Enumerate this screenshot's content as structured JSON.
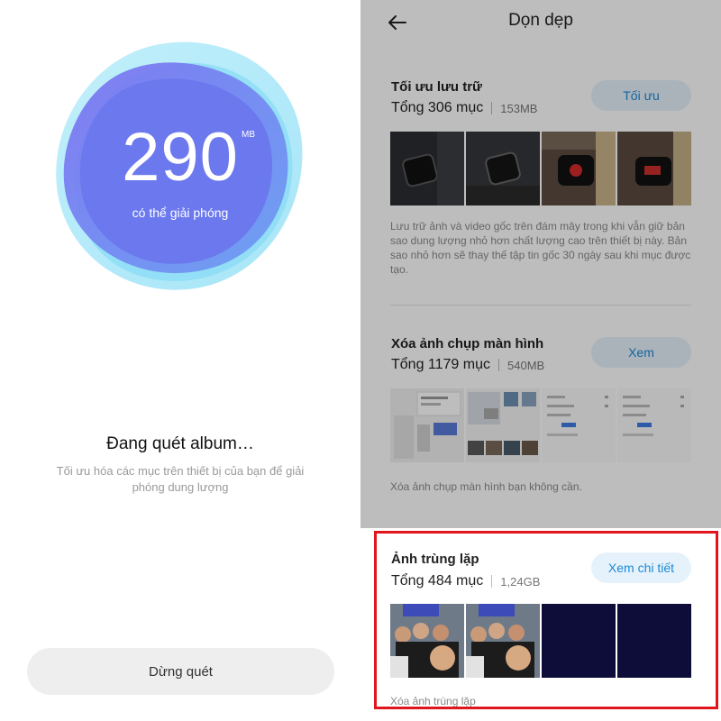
{
  "scan_screen": {
    "size_value": "290",
    "size_unit": "MB",
    "size_caption": "có thể giải phóng",
    "status_title": "Đang quét album…",
    "status_desc": "Tối ưu hóa các mục trên thiết bị của bạn để giải phóng dung lượng",
    "stop_button": "Dừng quét"
  },
  "cleanup_screen": {
    "title": "Dọn dẹp",
    "sections": [
      {
        "title": "Tối ưu lưu trữ",
        "count": "Tổng 306 mục",
        "size": "153MB",
        "button": "Tối ưu",
        "description": "Lưu trữ ảnh và video gốc trên đám mây trong khi vẫn giữ bản sao dung lượng nhỏ hơn chất lượng cao trên thiết bị này. Bản sao nhỏ hơn sẽ thay thế tập tin gốc 30 ngày sau khi mục được tạo.",
        "thumb_icons": [
          "smartwatch-photo-icon",
          "smartwatch-photo-icon",
          "smartwatch-wrist-photo-icon",
          "smartwatch-wrist-photo-icon"
        ]
      },
      {
        "title": "Xóa ảnh chụp màn hình",
        "count": "Tổng 1179 mục",
        "size": "540MB",
        "button": "Xem",
        "description": "Xóa ảnh chụp màn hình bạn không cần.",
        "thumb_icons": [
          "screenshot-dialog-icon",
          "screenshot-gallery-icon",
          "screenshot-settings-icon",
          "screenshot-settings-icon"
        ]
      },
      {
        "title": "Ảnh trùng lặp",
        "count": "Tổng 484 mục",
        "size": "1,24GB",
        "button": "Xem chi tiết",
        "description": "Xóa ảnh trùng lặp",
        "thumb_icons": [
          "group-photo-icon",
          "group-photo-icon",
          "dark-photo-icon",
          "dark-photo-icon"
        ]
      }
    ]
  },
  "colors": {
    "accent": "#1d88d6",
    "highlight_border": "#e0161c",
    "blob_main": "#6b78ee",
    "blob_light": "#6fd6f5"
  }
}
